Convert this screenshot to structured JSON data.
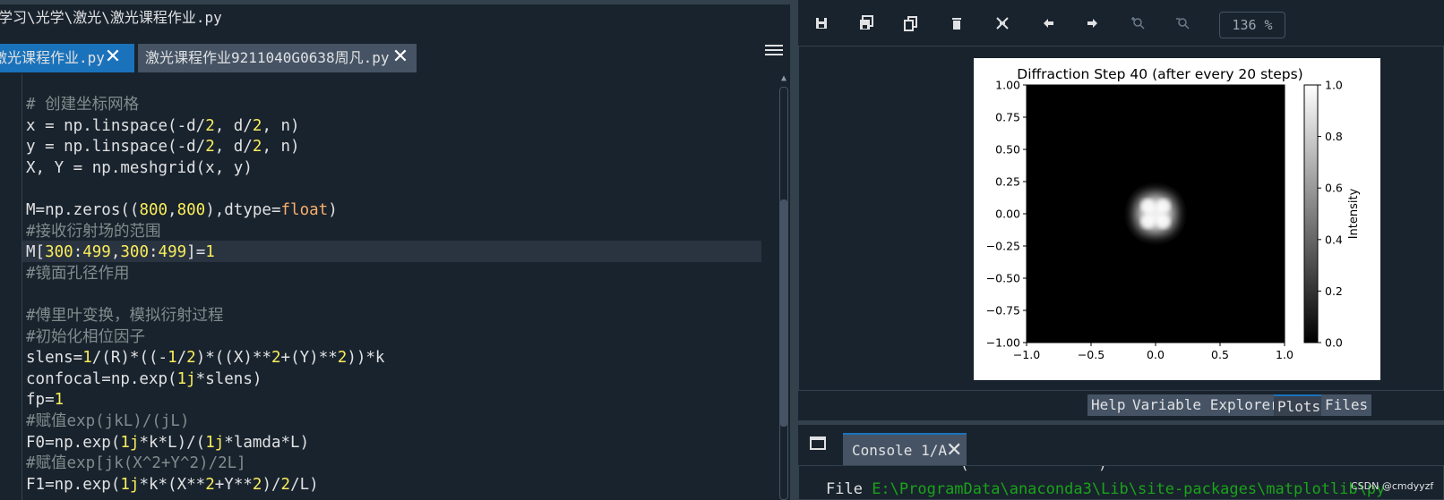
{
  "path_bar": "学习\\光学\\激光\\激光课程作业.py",
  "editor_tabs": [
    {
      "label": "激光课程作业.py",
      "active": true
    },
    {
      "label": "激光课程作业9211040G0638周凡.py",
      "active": false
    }
  ],
  "code_lines": [
    [
      {
        "t": "# 创建坐标网格",
        "c": "cm"
      }
    ],
    [
      {
        "t": "x = np.linspace(-d/",
        "c": ""
      },
      {
        "t": "2",
        "c": "num"
      },
      {
        "t": ", d/",
        "c": ""
      },
      {
        "t": "2",
        "c": "num"
      },
      {
        "t": ", n)",
        "c": ""
      }
    ],
    [
      {
        "t": "y = np.linspace(-d/",
        "c": ""
      },
      {
        "t": "2",
        "c": "num"
      },
      {
        "t": ", d/",
        "c": ""
      },
      {
        "t": "2",
        "c": "num"
      },
      {
        "t": ", n)",
        "c": ""
      }
    ],
    [
      {
        "t": "X, Y = np.meshgrid(x, y)",
        "c": ""
      }
    ],
    [],
    [
      {
        "t": "M=np.zeros((",
        "c": ""
      },
      {
        "t": "800",
        "c": "num"
      },
      {
        "t": ",",
        "c": ""
      },
      {
        "t": "800",
        "c": "num"
      },
      {
        "t": "),dtype=",
        "c": ""
      },
      {
        "t": "float",
        "c": "kw"
      },
      {
        "t": ")",
        "c": ""
      }
    ],
    [
      {
        "t": "#接收衍射场的范围",
        "c": "cm"
      }
    ],
    [
      {
        "t": "M[",
        "c": ""
      },
      {
        "t": "300",
        "c": "num"
      },
      {
        "t": ":",
        "c": ""
      },
      {
        "t": "499",
        "c": "num"
      },
      {
        "t": ",",
        "c": ""
      },
      {
        "t": "300",
        "c": "num"
      },
      {
        "t": ":",
        "c": ""
      },
      {
        "t": "499",
        "c": "num"
      },
      {
        "t": "]=",
        "c": ""
      },
      {
        "t": "1",
        "c": "num"
      }
    ],
    [
      {
        "t": "#镜面孔径作用",
        "c": "cm"
      }
    ],
    [],
    [
      {
        "t": "#傅里叶变换，模拟衍射过程",
        "c": "cm"
      }
    ],
    [
      {
        "t": "#初始化相位因子",
        "c": "cm"
      }
    ],
    [
      {
        "t": "slens=",
        "c": ""
      },
      {
        "t": "1",
        "c": "num"
      },
      {
        "t": "/(R)*((-",
        "c": ""
      },
      {
        "t": "1",
        "c": "num"
      },
      {
        "t": "/",
        "c": ""
      },
      {
        "t": "2",
        "c": "num"
      },
      {
        "t": ")*((X)**",
        "c": ""
      },
      {
        "t": "2",
        "c": "num"
      },
      {
        "t": "+(Y)**",
        "c": ""
      },
      {
        "t": "2",
        "c": "num"
      },
      {
        "t": "))*k",
        "c": ""
      }
    ],
    [
      {
        "t": "confocal=np.exp(",
        "c": ""
      },
      {
        "t": "1j",
        "c": "num"
      },
      {
        "t": "*slens)",
        "c": ""
      }
    ],
    [
      {
        "t": "fp=",
        "c": ""
      },
      {
        "t": "1",
        "c": "num"
      }
    ],
    [
      {
        "t": "#赋值exp(jkL)/(jL)",
        "c": "cm"
      }
    ],
    [
      {
        "t": "F0=np.exp(",
        "c": ""
      },
      {
        "t": "1j",
        "c": "num"
      },
      {
        "t": "*k*L)/(",
        "c": ""
      },
      {
        "t": "1j",
        "c": "num"
      },
      {
        "t": "*lamda*L)",
        "c": ""
      }
    ],
    [
      {
        "t": "#赋值exp[jk(X^2+Y^2)/2L]",
        "c": "cm"
      }
    ],
    [
      {
        "t": "F1=np.exp(",
        "c": ""
      },
      {
        "t": "1j",
        "c": "num"
      },
      {
        "t": "*k*(X**",
        "c": ""
      },
      {
        "t": "2",
        "c": "num"
      },
      {
        "t": "+Y**",
        "c": ""
      },
      {
        "t": "2",
        "c": "num"
      },
      {
        "t": ")/",
        "c": ""
      },
      {
        "t": "2",
        "c": "num"
      },
      {
        "t": "/L)",
        "c": ""
      }
    ]
  ],
  "toolbar_icons": [
    "save-icon",
    "save-all-icon",
    "copy-icon",
    "delete-icon",
    "close-all-icon",
    "back-arrow-icon",
    "forward-arrow-icon",
    "zoom-in-icon",
    "zoom-out-icon"
  ],
  "zoom_level": "136 %",
  "chart_data": {
    "type": "heatmap",
    "title": "Diffraction Step 40 (after every 20 steps)",
    "x_ticks": [
      "−1.0",
      "−0.5",
      "0.0",
      "0.5",
      "1.0"
    ],
    "y_ticks": [
      "1.00",
      "0.75",
      "0.50",
      "0.25",
      "0.00",
      "−0.25",
      "−0.50",
      "−0.75",
      "−1.00"
    ],
    "xlim": [
      -1.0,
      1.0
    ],
    "ylim": [
      -1.0,
      1.0
    ],
    "colorbar_label": "Intensity",
    "colorbar_ticks": [
      "1.0",
      "0.8",
      "0.6",
      "0.4",
      "0.2",
      "0.0"
    ],
    "colormap": "gray",
    "spot_center": [
      0.0,
      0.0
    ],
    "spot_half_width": 0.2
  },
  "pane_tabs": [
    {
      "label": "Help",
      "active": false
    },
    {
      "label": "Variable Explorer",
      "active": false
    },
    {
      "label": "Plots",
      "active": true
    },
    {
      "label": "Files",
      "active": false
    }
  ],
  "console": {
    "tab_label": "Console 1/A",
    "line1": "(               )",
    "line2_prefix": "File ",
    "line2_path": "E:\\ProgramData\\anaconda3\\Lib\\site-packages\\matplotlib\\py"
  },
  "watermark": "CSDN @cmdyyzf"
}
